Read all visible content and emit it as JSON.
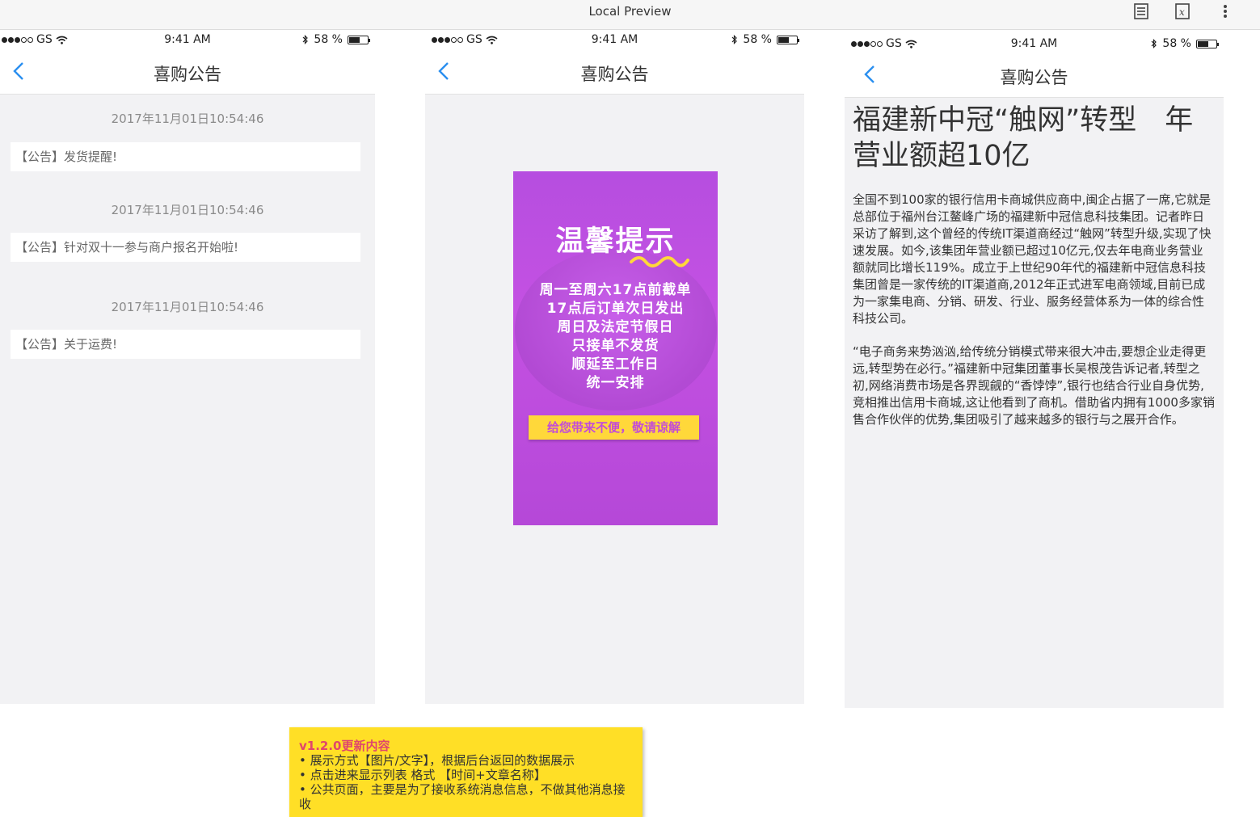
{
  "viewer": {
    "title": "Local Preview",
    "tools": [
      "document-icon",
      "formula-icon",
      "more-vertical-icon"
    ]
  },
  "status": {
    "carrier": "GS",
    "time": "9:41 AM",
    "battery": "58 %",
    "battery_level": 0.58
  },
  "nav": {
    "title": "喜购公告"
  },
  "list": {
    "items": [
      {
        "time": "2017年11月01日10:54:46",
        "title": "【公告】发货提醒!"
      },
      {
        "time": "2017年11月01日10:54:46",
        "title": "【公告】针对双十一参与商户报名开始啦!"
      },
      {
        "time": "2017年11月01日10:54:46",
        "title": "【公告】关于运费!"
      }
    ]
  },
  "poster": {
    "title": "温馨提示",
    "lines": [
      "周一至周六17点前截单",
      "17点后订单次日发出",
      "周日及法定节假日",
      "只接单不发货",
      "顺延至工作日",
      "统一安排"
    ],
    "badge": "给您带来不便，敬请谅解"
  },
  "article": {
    "title": "福建新中冠“触网”转型　年营业额超10亿",
    "paragraphs": [
      "全国不到100家的银行信用卡商城供应商中,闽企占据了一席,它就是总部位于福州台江鳌峰广场的福建新中冠信息科技集团。记者昨日采访了解到,这个曾经的传统IT渠道商经过“触网”转型升级,实现了快速发展。如今,该集团年营业额已超过10亿元,仅去年电商业务营业额就同比增长119%。成立于上世纪90年代的福建新中冠信息科技集团曾是一家传统的IT渠道商,2012年正式进军电商领域,目前已成为一家集电商、分销、研发、行业、服务经营体系为一体的综合性科技公司。",
      "“电子商务来势汹汹,给传统分销模式带来很大冲击,要想企业走得更远,转型势在必行。”福建新中冠集团董事长吴根茂告诉记者,转型之初,网络消费市场是各界觊觎的“香饽饽”,银行也结合行业自身优势,竞相推出信用卡商城,这让他看到了商机。借助省内拥有1000多家销售合作伙伴的优势,集团吸引了越来越多的银行与之展开合作。"
    ]
  },
  "note": {
    "title": "v1.2.0更新内容",
    "items": [
      "• 展示方式【图片/文字】，根据后台返回的数据展示",
      "• 点击进来显示列表 格式 【时间+文章名称】",
      "• 公共页面，主要是为了接收系统消息信息，不做其他消息接收"
    ]
  },
  "colors": {
    "accent": "#2a8ff0",
    "note_bg": "#ffdf26",
    "note_title": "#e0466c",
    "poster_bg": "#bd4fe0"
  }
}
